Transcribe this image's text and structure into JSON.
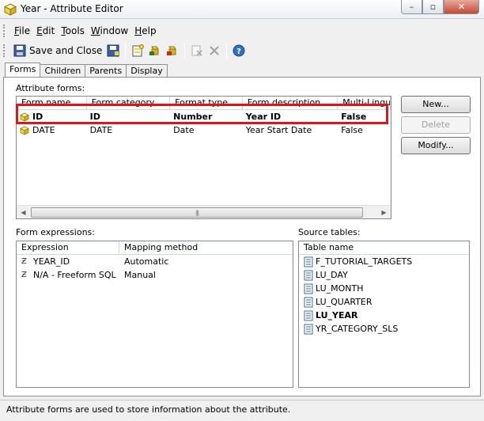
{
  "window": {
    "title": "Year - Attribute Editor",
    "controls": {
      "minimize": "–",
      "maximize": "▫",
      "close": "✕"
    }
  },
  "menubar": {
    "items": [
      "File",
      "Edit",
      "Tools",
      "Window",
      "Help"
    ]
  },
  "toolbar": {
    "save_close_label": "Save and Close",
    "icons": [
      "save-close-icon",
      "save-icon",
      "new-form-icon",
      "modify-form-icon",
      "delete-form-icon",
      "properties-icon",
      "delete-icon",
      "help-icon"
    ]
  },
  "tabs": [
    "Forms",
    "Children",
    "Parents",
    "Display"
  ],
  "attribute_forms": {
    "label": "Attribute forms:",
    "columns": [
      "Form name",
      "Form category",
      "Format type",
      "Form description",
      "Multi-Lingual"
    ],
    "rows": [
      {
        "name": "ID",
        "category": "ID",
        "format": "Number",
        "description": "Year ID",
        "multilingual": "False",
        "bold": true
      },
      {
        "name": "DATE",
        "category": "DATE",
        "format": "Date",
        "description": "Year Start Date",
        "multilingual": "False",
        "bold": false
      }
    ]
  },
  "buttons": {
    "new": "New...",
    "delete": "Delete",
    "modify": "Modify..."
  },
  "form_expressions": {
    "label": "Form expressions:",
    "columns": [
      "Expression",
      "Mapping method"
    ],
    "rows": [
      {
        "expression": "YEAR_ID",
        "mapping": "Automatic"
      },
      {
        "expression": "N/A - Freeform SQL",
        "mapping": "Manual"
      }
    ]
  },
  "source_tables": {
    "label": "Source tables:",
    "column": "Table name",
    "rows": [
      {
        "name": "F_TUTORIAL_TARGETS",
        "bold": false
      },
      {
        "name": "LU_DAY",
        "bold": false
      },
      {
        "name": "LU_MONTH",
        "bold": false
      },
      {
        "name": "LU_QUARTER",
        "bold": false
      },
      {
        "name": "LU_YEAR",
        "bold": true
      },
      {
        "name": "YR_CATEGORY_SLS",
        "bold": false
      }
    ]
  },
  "status": "Attribute forms are used to store information about the attribute.",
  "colors": {
    "highlight": "#e0151c",
    "icon_yellow": "#f5d33b"
  }
}
